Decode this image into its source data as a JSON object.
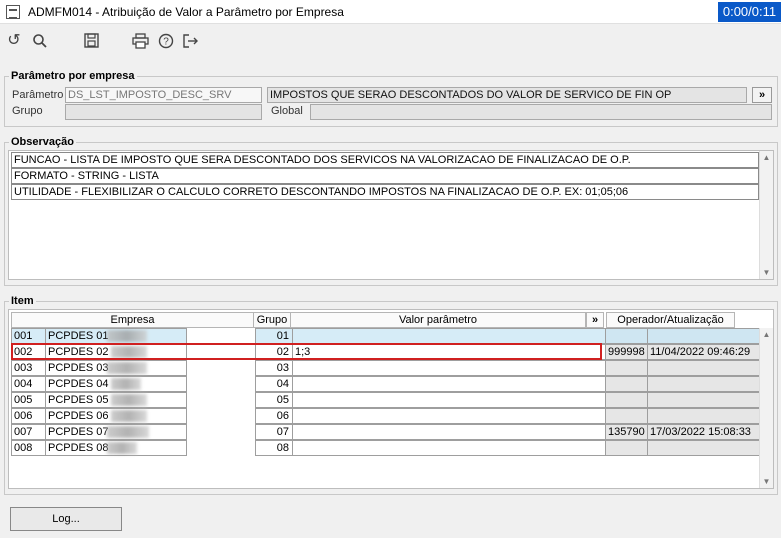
{
  "window": {
    "title": "ADMFM014 - Atribuição de Valor a Parâmetro por Empresa",
    "timer": "0:00/0:11"
  },
  "toolbar": {
    "icons": [
      "refresh-icon",
      "search-icon",
      "save-icon",
      "print-icon",
      "help-icon",
      "exit-icon"
    ]
  },
  "param_section": {
    "legend": "Parâmetro por empresa",
    "parametro_label": "Parâmetro",
    "parametro_value": "DS_LST_IMPOSTO_DESC_SRV",
    "descricao": "IMPOSTOS QUE SERAO DESCONTADOS DO VALOR DE SERVICO DE FIN OP",
    "expand_label": "»",
    "grupo_label": "Grupo",
    "global_label": "Global"
  },
  "observacao": {
    "legend": "Observação",
    "lines": [
      "FUNCAO - LISTA DE IMPOSTO QUE SERA DESCONTADO DOS SERVICOS NA VALORIZACAO DE FINALIZACAO DE O.P.",
      "FORMATO - STRING - LISTA",
      "UTILIDADE - FLEXIBILIZAR O CALCULO CORRETO DESCONTANDO IMPOSTOS NA FINALIZACAO DE O.P. EX: 01;05;06"
    ]
  },
  "item": {
    "legend": "Item",
    "headers": {
      "empresa": "Empresa",
      "grupo": "Grupo",
      "valor": "Valor parâmetro",
      "expand": "»",
      "operador": "Operador/Atualização"
    },
    "rows": [
      {
        "code": "001",
        "name": "PCPDES 01",
        "grupo": "01",
        "valor": "",
        "operador": "",
        "data": ""
      },
      {
        "code": "002",
        "name": "PCPDES 02",
        "grupo": "02",
        "valor": "1;3",
        "operador": "999998",
        "data": "11/04/2022 09:46:29"
      },
      {
        "code": "003",
        "name": "PCPDES 03",
        "grupo": "03",
        "valor": "",
        "operador": "",
        "data": ""
      },
      {
        "code": "004",
        "name": "PCPDES 04",
        "grupo": "04",
        "valor": "",
        "operador": "",
        "data": ""
      },
      {
        "code": "005",
        "name": "PCPDES 05",
        "grupo": "05",
        "valor": "",
        "operador": "",
        "data": ""
      },
      {
        "code": "006",
        "name": "PCPDES 06",
        "grupo": "06",
        "valor": "",
        "operador": "",
        "data": ""
      },
      {
        "code": "007",
        "name": "PCPDES 07",
        "grupo": "07",
        "valor": "",
        "operador": "135790",
        "data": "17/03/2022 15:08:33"
      },
      {
        "code": "008",
        "name": "PCPDES 08",
        "grupo": "08",
        "valor": "",
        "operador": "",
        "data": ""
      }
    ]
  },
  "footer": {
    "log_label": "Log..."
  }
}
